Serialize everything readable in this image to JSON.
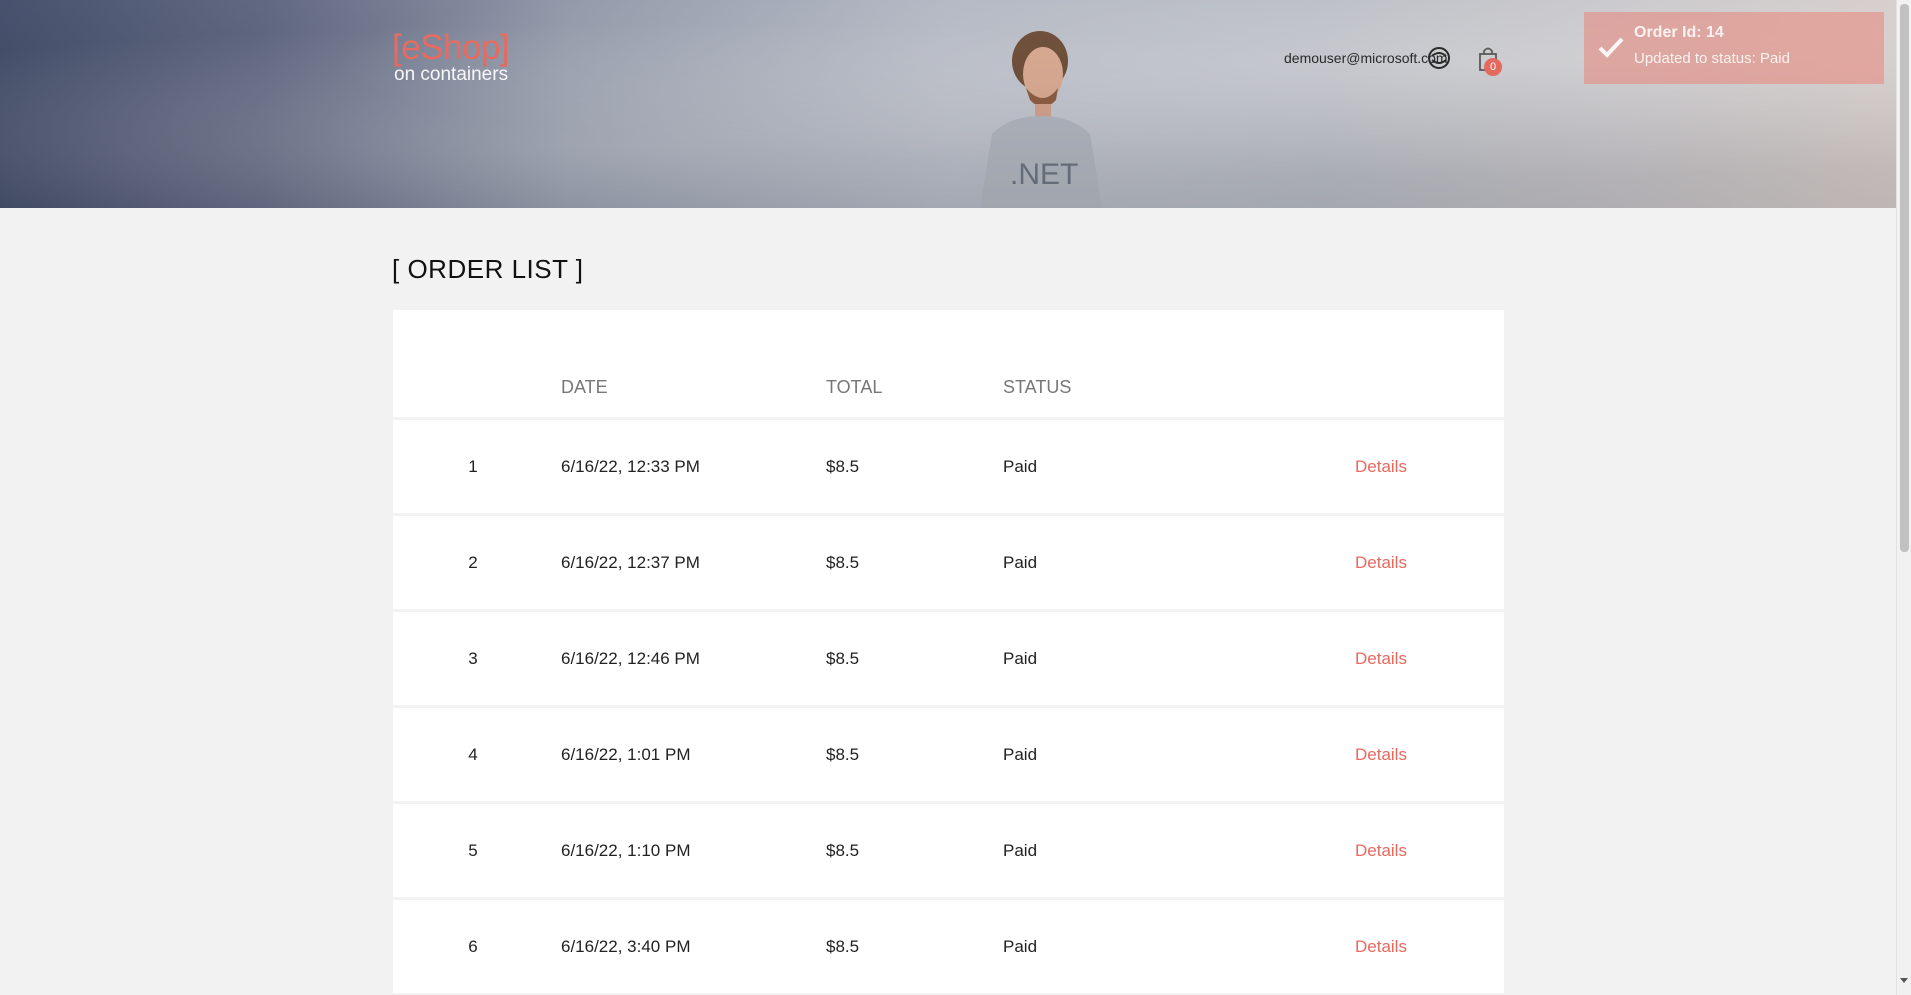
{
  "header": {
    "logo_main": "[eShop]",
    "logo_sub": "on containers",
    "user_email": "demouser@microsoft.com",
    "user_icon": "user-identity-icon",
    "cart_icon": "shopping-bag-icon",
    "cart_count": "0"
  },
  "toast": {
    "icon": "check-icon",
    "title": "Order Id: 14",
    "message": "Updated to status: Paid"
  },
  "page": {
    "title": "[ ORDER LIST ]"
  },
  "orders": {
    "columns": [
      "DATE",
      "TOTAL",
      "STATUS"
    ],
    "rows": [
      {
        "number": "1",
        "date": "6/16/22, 12:33 PM",
        "total": "$8.5",
        "status": "Paid",
        "link": "Details"
      },
      {
        "number": "2",
        "date": "6/16/22, 12:37 PM",
        "total": "$8.5",
        "status": "Paid",
        "link": "Details"
      },
      {
        "number": "3",
        "date": "6/16/22, 12:46 PM",
        "total": "$8.5",
        "status": "Paid",
        "link": "Details"
      },
      {
        "number": "4",
        "date": "6/16/22, 1:01 PM",
        "total": "$8.5",
        "status": "Paid",
        "link": "Details"
      },
      {
        "number": "5",
        "date": "6/16/22, 1:10 PM",
        "total": "$8.5",
        "status": "Paid",
        "link": "Details"
      },
      {
        "number": "6",
        "date": "6/16/22, 3:40 PM",
        "total": "$8.5",
        "status": "Paid",
        "link": "Details"
      }
    ]
  },
  "colors": {
    "accent": "#e9675c",
    "background": "#f2f2f2",
    "card": "#ffffff"
  }
}
